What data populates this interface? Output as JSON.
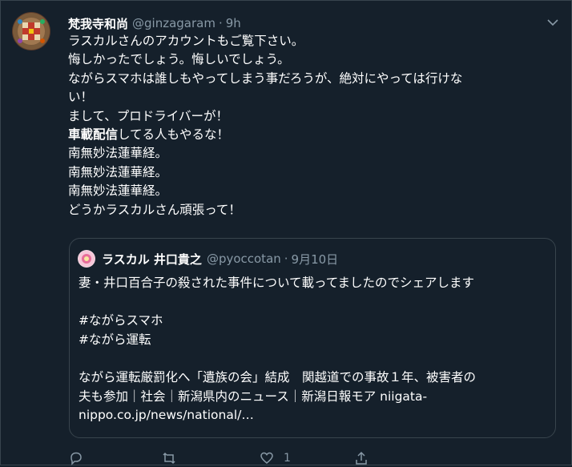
{
  "tweet": {
    "display_name": "梵我寺和尚",
    "handle": "@ginzagaram",
    "separator": "·",
    "time": "9h",
    "lines": [
      "ラスカルさんのアカウントもご覧下さい。",
      "悔しかったでしょう。悔しいでしょう。",
      "ながらスマホは誰しもやってしまう事だろうが、絶対にやっては行けな",
      "い！",
      "まして、プロドライバーが！"
    ],
    "line6_bold": "車載配信",
    "line6_rest": "してる人もやるな！",
    "lines_after": [
      "南無妙法蓮華経。",
      "南無妙法蓮華経。",
      "南無妙法蓮華経。",
      "どうかラスカルさん頑張って！"
    ]
  },
  "quote": {
    "display_name": "ラスカル 井口貴之",
    "handle": "@pyoccotan",
    "separator": "·",
    "date": "9月10日",
    "lines": [
      "妻・井口百合子の殺された事件について載ってましたのでシェアします",
      "",
      "#ながらスマホ",
      "#ながら運転",
      "",
      "ながら運転厳罰化へ「遺族の会」結成　関越道での事故１年、被害者の",
      "夫も参加｜社会｜新潟県内のニュース｜新潟日報モア niigata-",
      "nippo.co.jp/news/national/…"
    ]
  },
  "actions": {
    "reply_icon": "reply-icon",
    "retweet_icon": "retweet-icon",
    "like_icon": "heart-icon",
    "like_count": "1",
    "share_icon": "share-icon"
  },
  "colors": {
    "background": "#15202b",
    "border": "#38444d",
    "secondary_text": "#8899a6",
    "primary_text": "#ffffff"
  }
}
